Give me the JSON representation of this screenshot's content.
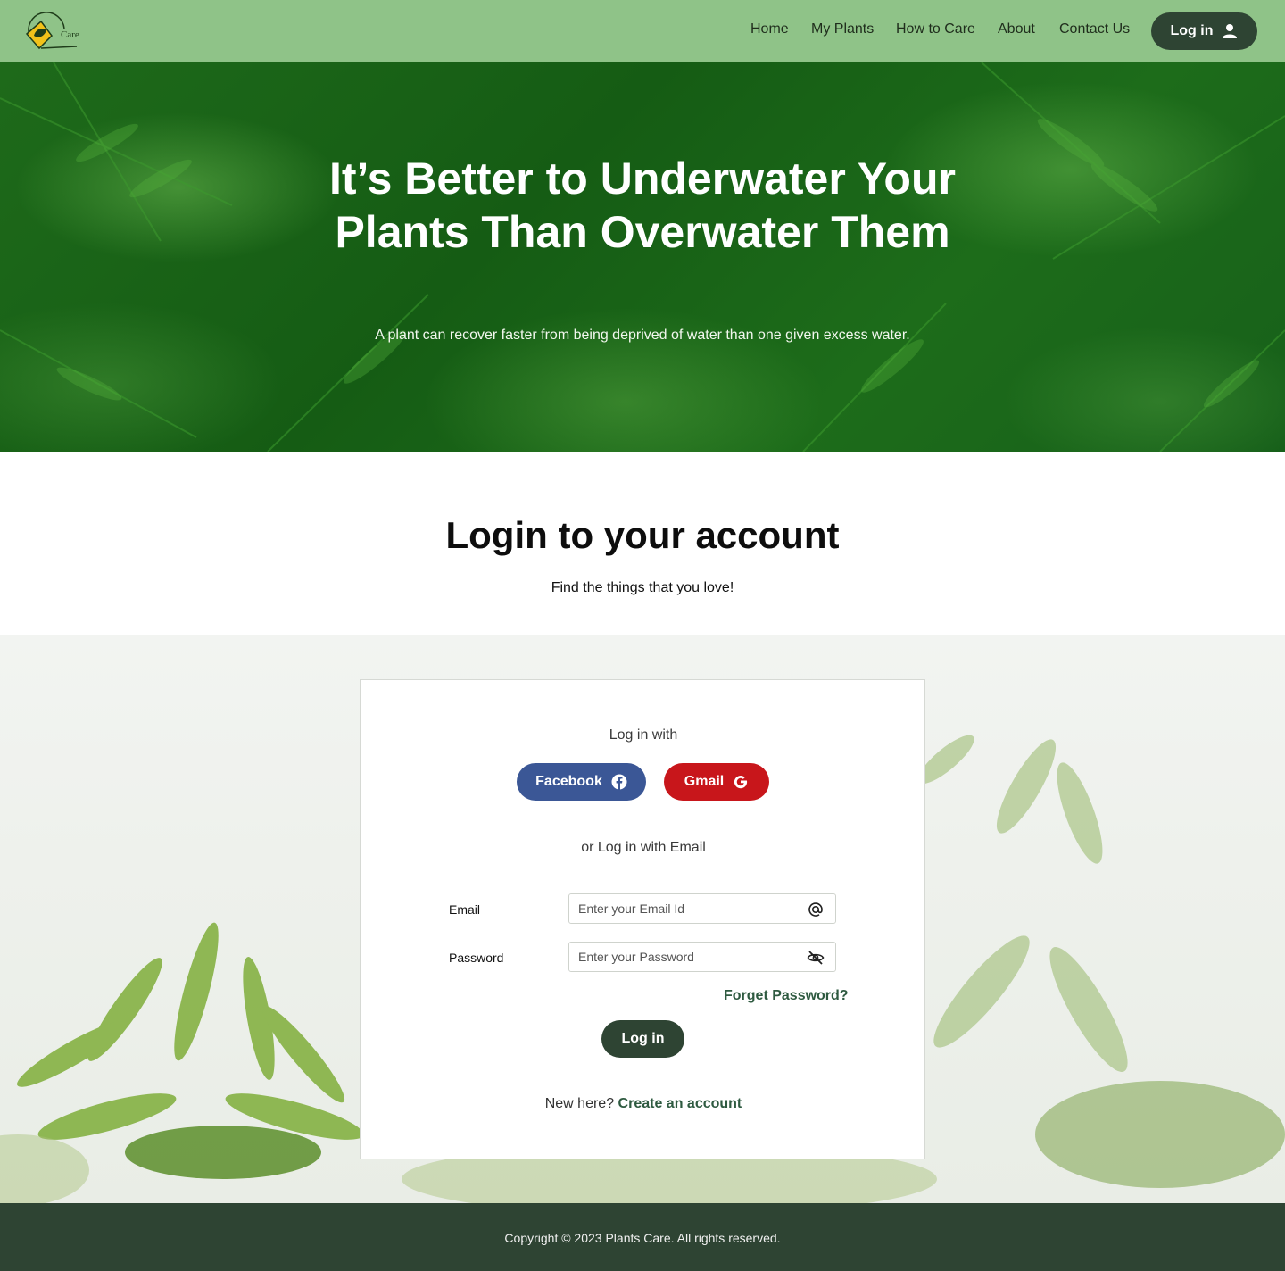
{
  "brand": {
    "logo_text": "Care"
  },
  "nav": {
    "links": [
      "Home",
      "My Plants",
      "How to Care",
      "About",
      "Contact Us"
    ],
    "login_label": "Log in"
  },
  "hero": {
    "title": "It’s Better to Underwater Your Plants Than Overwater Them",
    "subtitle": "A plant can recover faster from being deprived of water than one given excess water."
  },
  "login_section": {
    "title": "Login to your account",
    "subtitle": "Find the things that you love!"
  },
  "card": {
    "login_with": "Log in with",
    "facebook_label": "Facebook",
    "gmail_label": "Gmail",
    "or_email": "or Log in with Email",
    "email_label": "Email",
    "email_placeholder": "Enter your Email Id",
    "password_label": "Password",
    "password_placeholder": "Enter your Password",
    "forget_label": "Forget Password?",
    "login_button": "Log in",
    "new_here": "New here?",
    "create_account": "Create an account"
  },
  "footer": {
    "copyright": "Copyright © 2023 Plants Care. All rights reserved."
  },
  "colors": {
    "nav_bg": "#8fc388",
    "dark_green": "#2e4433",
    "facebook": "#3b5796",
    "gmail": "#c8161b",
    "link_green": "#2e5a40"
  }
}
